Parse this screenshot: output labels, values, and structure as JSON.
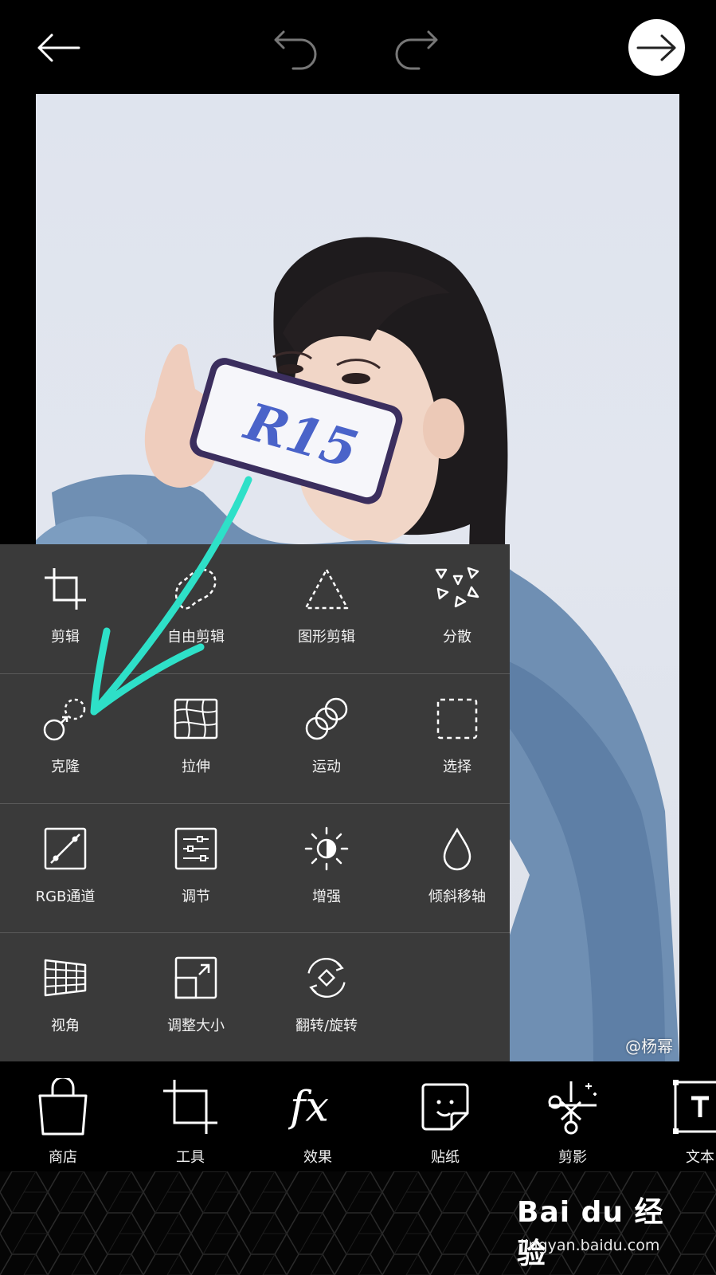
{
  "toolbar": {
    "back": "back-arrow-icon",
    "undo": "undo-icon",
    "redo": "redo-icon",
    "next": "next-arrow-icon"
  },
  "photo": {
    "watermark": "@杨幂",
    "phone_text": "R15"
  },
  "tools": [
    [
      {
        "label": "剪辑",
        "icon": "crop-icon"
      },
      {
        "label": "自由剪辑",
        "icon": "free-crop-icon"
      },
      {
        "label": "图形剪辑",
        "icon": "shape-crop-icon"
      },
      {
        "label": "分散",
        "icon": "disperse-icon"
      }
    ],
    [
      {
        "label": "克隆",
        "icon": "clone-icon"
      },
      {
        "label": "拉伸",
        "icon": "stretch-icon"
      },
      {
        "label": "运动",
        "icon": "motion-icon"
      },
      {
        "label": "选择",
        "icon": "select-icon"
      }
    ],
    [
      {
        "label": "RGB通道",
        "icon": "curves-icon"
      },
      {
        "label": "调节",
        "icon": "adjust-icon"
      },
      {
        "label": "增强",
        "icon": "enhance-icon"
      },
      {
        "label": "倾斜移轴",
        "icon": "tilt-shift-icon"
      }
    ],
    [
      {
        "label": "视角",
        "icon": "perspective-icon"
      },
      {
        "label": "调整大小",
        "icon": "resize-icon"
      },
      {
        "label": "翻转/旋转",
        "icon": "flip-rotate-icon"
      }
    ]
  ],
  "bottom_nav": [
    {
      "label": "商店",
      "icon": "shopping-bag-icon"
    },
    {
      "label": "工具",
      "icon": "crop-tool-icon"
    },
    {
      "label": "效果",
      "icon": "fx-icon"
    },
    {
      "label": "贴纸",
      "icon": "sticker-icon"
    },
    {
      "label": "剪影",
      "icon": "cutout-icon"
    },
    {
      "label": "文本",
      "icon": "text-icon"
    }
  ],
  "branding": {
    "logo": "Bai du 经验",
    "url": "jingyan.baidu.com"
  },
  "colors": {
    "panel_bg": "#3a3a3a",
    "annotation_arrow": "#2ee0c8"
  }
}
